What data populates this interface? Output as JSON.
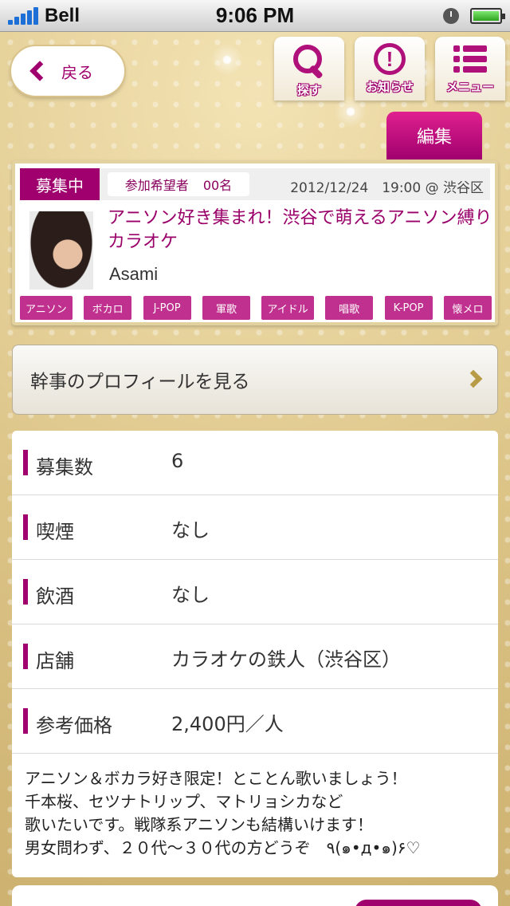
{
  "status_bar": {
    "carrier": "Bell",
    "time": "9:06 PM"
  },
  "nav": {
    "back_label": "戻る",
    "search_label": "探す",
    "notice_label": "お知らせ",
    "menu_label": "メニュー",
    "edit_label": "編集"
  },
  "event": {
    "status": "募集中",
    "applicants_label": "参加希望者",
    "applicants_count": "00名",
    "datetime": "2012/12/24　19:00 @ 渋谷区",
    "title": "アニソン好き集まれ！渋谷で萌えるアニソン縛りカラオケ",
    "host": "Asami",
    "tags": [
      "アニソン",
      "ボカロ",
      "J-POP",
      "軍歌",
      "アイドル",
      "唱歌",
      "K-POP",
      "懐メロ"
    ]
  },
  "profile_button": {
    "label": "幹事のプロフィールを見る"
  },
  "details": {
    "rows": [
      {
        "label": "募集数",
        "value": "6"
      },
      {
        "label": "喫煙",
        "value": "なし"
      },
      {
        "label": "飲酒",
        "value": "なし"
      },
      {
        "label": "店舗",
        "value": "カラオケの鉄人（渋谷区）"
      },
      {
        "label": "参考価格",
        "value": "2,400円／人"
      }
    ],
    "description": "アニソン＆ボカラ好き限定！とことん歌いましょう！\n千本桜、セツナトリップ、マトリョシカなど\n歌いたいです。戦隊系アニソンも結構いけます！\n男女問わず、２０代〜３０代の方どうぞ　٩(๑•д•๑)۶♡"
  },
  "colors": {
    "accent": "#a0006e",
    "tag": "#c0308f",
    "gold": "#dcc487"
  }
}
